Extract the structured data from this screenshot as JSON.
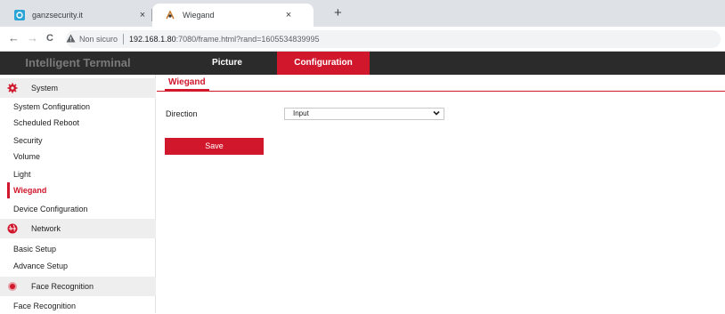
{
  "browser": {
    "tabs": [
      {
        "title": "ganzsecurity.it",
        "close": "×",
        "active": false
      },
      {
        "title": "Wiegand",
        "close": "×",
        "active": true
      }
    ],
    "new_tab": "+",
    "nav": {
      "back": "←",
      "forward": "→",
      "reload": "C"
    },
    "address": {
      "security": "Non sicuro",
      "host": "192.168.1.80",
      "path": ":7080/frame.html?rand=1605534839995"
    }
  },
  "header": {
    "brand": "Intelligent Terminal",
    "tabs": [
      {
        "label": "Picture",
        "active": false
      },
      {
        "label": "Configuration",
        "active": true
      }
    ]
  },
  "sidebar": {
    "sections": [
      {
        "label": "System",
        "icon": "gear-icon",
        "items": [
          {
            "label": "System Configuration"
          },
          {
            "label": "Scheduled Reboot"
          },
          {
            "label": "Security"
          },
          {
            "label": "Volume"
          },
          {
            "label": "Light"
          },
          {
            "label": "Wiegand",
            "active": true
          },
          {
            "label": "Device Configuration"
          }
        ]
      },
      {
        "label": "Network",
        "icon": "globe-icon",
        "items": [
          {
            "label": "Basic Setup"
          },
          {
            "label": "Advance Setup"
          }
        ]
      },
      {
        "label": "Face Recognition",
        "icon": "face-icon",
        "items": [
          {
            "label": "Face Recognition"
          }
        ]
      }
    ]
  },
  "main": {
    "subtab": "Wiegand",
    "form": {
      "direction_label": "Direction",
      "direction_value": "Input"
    },
    "save_label": "Save"
  },
  "colors": {
    "accent": "#d0172c",
    "header_bg": "#2b2b2b",
    "section_bg": "#eeeeee"
  }
}
